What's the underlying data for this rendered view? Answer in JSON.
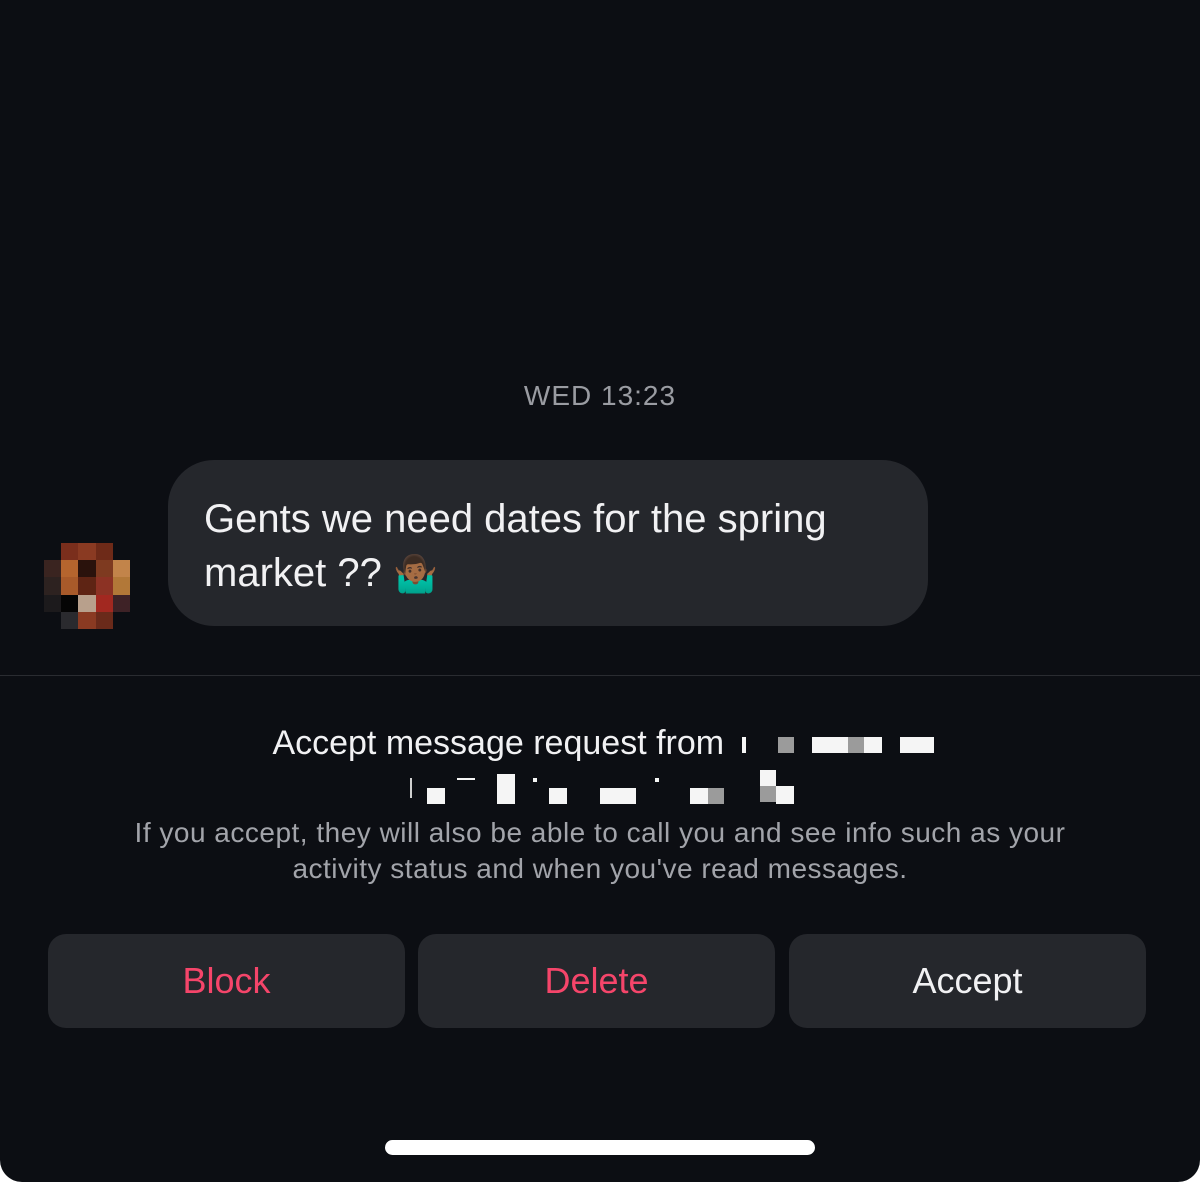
{
  "colors": {
    "background": "#0c0e13",
    "bubble": "#25272c",
    "danger": "#f5456a",
    "primary_text": "#f1f1f3",
    "secondary_text": "#a2a4aa"
  },
  "conversation": {
    "timestamp": "WED 13:23",
    "message_line1": "Gents we need dates for the spring",
    "message_line2": "market ??",
    "message_emoji": "🤷🏾‍♂️"
  },
  "request": {
    "title_prefix": "Accept message request from",
    "info_line1": "If you accept, they will also be able to call you and see info such as your",
    "info_line2": "activity status and when you've read messages."
  },
  "actions": {
    "block_label": "Block",
    "delete_label": "Delete",
    "accept_label": "Accept"
  }
}
